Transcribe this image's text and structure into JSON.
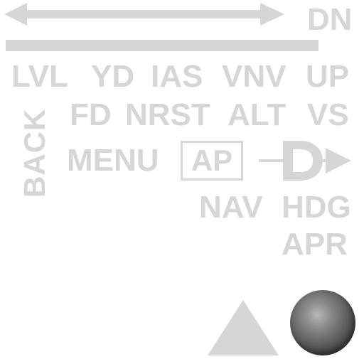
{
  "colors": {
    "label": "#d6d6d6",
    "knob": "#6a6a6a"
  },
  "top": {
    "arrow_icon": "double-headed-arrow-icon",
    "dn": "DN"
  },
  "row1": {
    "lvl": "LVL",
    "yd": "YD",
    "ias": "IAS",
    "vnv": "VNV",
    "up": "UP"
  },
  "row2": {
    "fd": "FD",
    "nrst": "NRST",
    "alt": "ALT",
    "vs": "VS"
  },
  "row3": {
    "menu": "MENU",
    "ap": "AP",
    "direct_to_icon": "direct-to-icon"
  },
  "row4": {
    "nav": "NAV",
    "hdg": "HDG"
  },
  "row5": {
    "apr": "APR"
  },
  "side": {
    "back": "BACK"
  },
  "bottom": {
    "triangle_icon": "triangle-up-icon",
    "knob_icon": "knob-icon"
  }
}
